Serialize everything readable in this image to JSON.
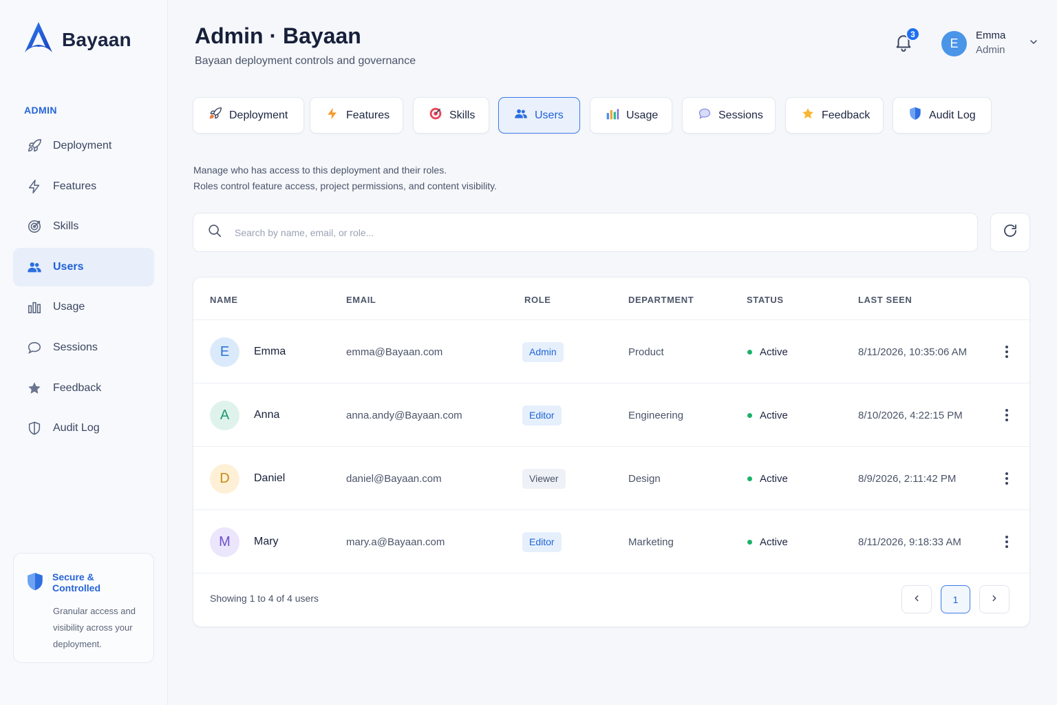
{
  "brand": {
    "name": "Bayaan"
  },
  "sidebar": {
    "section_label": "ADMIN",
    "items": [
      {
        "label": "Deployment",
        "icon": "rocket-icon",
        "active": false
      },
      {
        "label": "Features",
        "icon": "bolt-icon",
        "active": false
      },
      {
        "label": "Skills",
        "icon": "target-icon",
        "active": false
      },
      {
        "label": "Users",
        "icon": "users-icon",
        "active": true
      },
      {
        "label": "Usage",
        "icon": "bar-chart-icon",
        "active": false
      },
      {
        "label": "Sessions",
        "icon": "chat-bubble-icon",
        "active": false
      },
      {
        "label": "Feedback",
        "icon": "star-icon",
        "active": false
      },
      {
        "label": "Audit Log",
        "icon": "shield-icon",
        "active": false
      }
    ],
    "secure_card": {
      "title": "Secure & Controlled",
      "text": "Granular access and visibility across your deployment."
    }
  },
  "header": {
    "title": "Admin · Bayaan",
    "subtitle": "Bayaan deployment controls and governance",
    "notification_count": "3",
    "user": {
      "initial": "E",
      "name": "Emma",
      "role": "Admin"
    }
  },
  "tabs": [
    {
      "label": "Deployment",
      "icon": "rocket-icon",
      "active": false
    },
    {
      "label": "Features",
      "icon": "bolt-icon",
      "active": false
    },
    {
      "label": "Skills",
      "icon": "target-icon",
      "active": false
    },
    {
      "label": "Users",
      "icon": "users-icon",
      "active": true
    },
    {
      "label": "Usage",
      "icon": "bar-chart-icon",
      "active": false
    },
    {
      "label": "Sessions",
      "icon": "chat-bubble-icon",
      "active": false
    },
    {
      "label": "Feedback",
      "icon": "star-icon",
      "active": false
    },
    {
      "label": "Audit Log",
      "icon": "shield-icon",
      "active": false
    }
  ],
  "description": {
    "line1": "Manage who has access to this deployment and their roles.",
    "line2": "Roles control feature access, project permissions, and content visibility."
  },
  "search": {
    "placeholder": "Search by name, email, or role...",
    "value": ""
  },
  "table": {
    "columns": [
      "NAME",
      "EMAIL",
      "ROLE",
      "DEPARTMENT",
      "STATUS",
      "LAST SEEN"
    ],
    "rows": [
      {
        "initial": "E",
        "name": "Emma",
        "email": "emma@Bayaan.com",
        "role": "Admin",
        "department": "Product",
        "status": "Active",
        "last_seen": "8/11/2026, 10:35:06 AM",
        "avatar_bg": "#dbeafb",
        "avatar_fg": "#2b74d6",
        "role_bg": "#e6f0fc",
        "role_fg": "#1e63d6"
      },
      {
        "initial": "A",
        "name": "Anna",
        "email": "anna.andy@Bayaan.com",
        "role": "Editor",
        "department": "Engineering",
        "status": "Active",
        "last_seen": "8/10/2026, 4:22:15 PM",
        "avatar_bg": "#dff3ec",
        "avatar_fg": "#1d9a6c",
        "role_bg": "#e6f0fc",
        "role_fg": "#1e63d6"
      },
      {
        "initial": "D",
        "name": "Daniel",
        "email": "daniel@Bayaan.com",
        "role": "Viewer",
        "department": "Design",
        "status": "Active",
        "last_seen": "8/9/2026, 2:11:42 PM",
        "avatar_bg": "#fdf0d6",
        "avatar_fg": "#c98a12",
        "role_bg": "#eef1f5",
        "role_fg": "#4a5368"
      },
      {
        "initial": "M",
        "name": "Mary",
        "email": "mary.a@Bayaan.com",
        "role": "Editor",
        "department": "Marketing",
        "status": "Active",
        "last_seen": "8/11/2026, 9:18:33 AM",
        "avatar_bg": "#ebe6fb",
        "avatar_fg": "#6b4fd0",
        "role_bg": "#e6f0fc",
        "role_fg": "#1e63d6"
      }
    ],
    "footer": "Showing 1 to 4 of 4 users",
    "current_page": "1"
  },
  "colors": {
    "accent": "#1e5fd8",
    "status_active": "#19b26b"
  }
}
